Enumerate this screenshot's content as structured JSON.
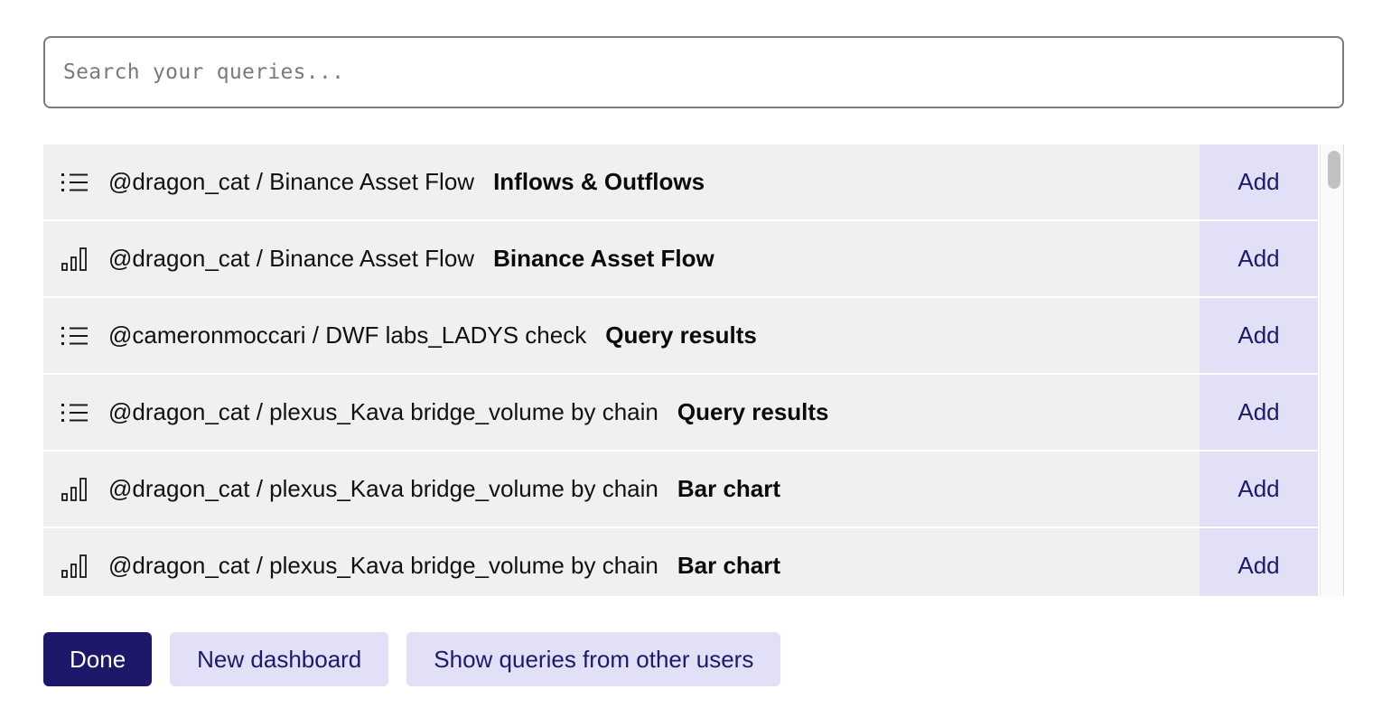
{
  "search": {
    "placeholder": "Search your queries...",
    "value": ""
  },
  "queries": [
    {
      "icon": "list-icon",
      "path": "@dragon_cat / Binance Asset Flow",
      "title": "Inflows & Outflows",
      "action": "Add"
    },
    {
      "icon": "bar-chart-icon",
      "path": "@dragon_cat / Binance Asset Flow",
      "title": "Binance Asset Flow",
      "action": "Add"
    },
    {
      "icon": "list-icon",
      "path": "@cameronmoccari / DWF labs_LADYS check",
      "title": "Query results",
      "action": "Add"
    },
    {
      "icon": "list-icon",
      "path": "@dragon_cat / plexus_Kava bridge_volume by chain",
      "title": "Query results",
      "action": "Add"
    },
    {
      "icon": "bar-chart-icon",
      "path": "@dragon_cat / plexus_Kava bridge_volume by chain",
      "title": "Bar chart",
      "action": "Add"
    },
    {
      "icon": "bar-chart-icon",
      "path": "@dragon_cat / plexus_Kava bridge_volume by chain",
      "title": "Bar chart",
      "action": "Add"
    }
  ],
  "footer": {
    "done_label": "Done",
    "new_dashboard_label": "New dashboard",
    "show_other_users_label": "Show queries from other users"
  },
  "colors": {
    "row_background": "#f0f0f0",
    "add_background": "#e1e0f6",
    "accent": "#1e186b",
    "secondary_button": "#e1e0f6"
  }
}
